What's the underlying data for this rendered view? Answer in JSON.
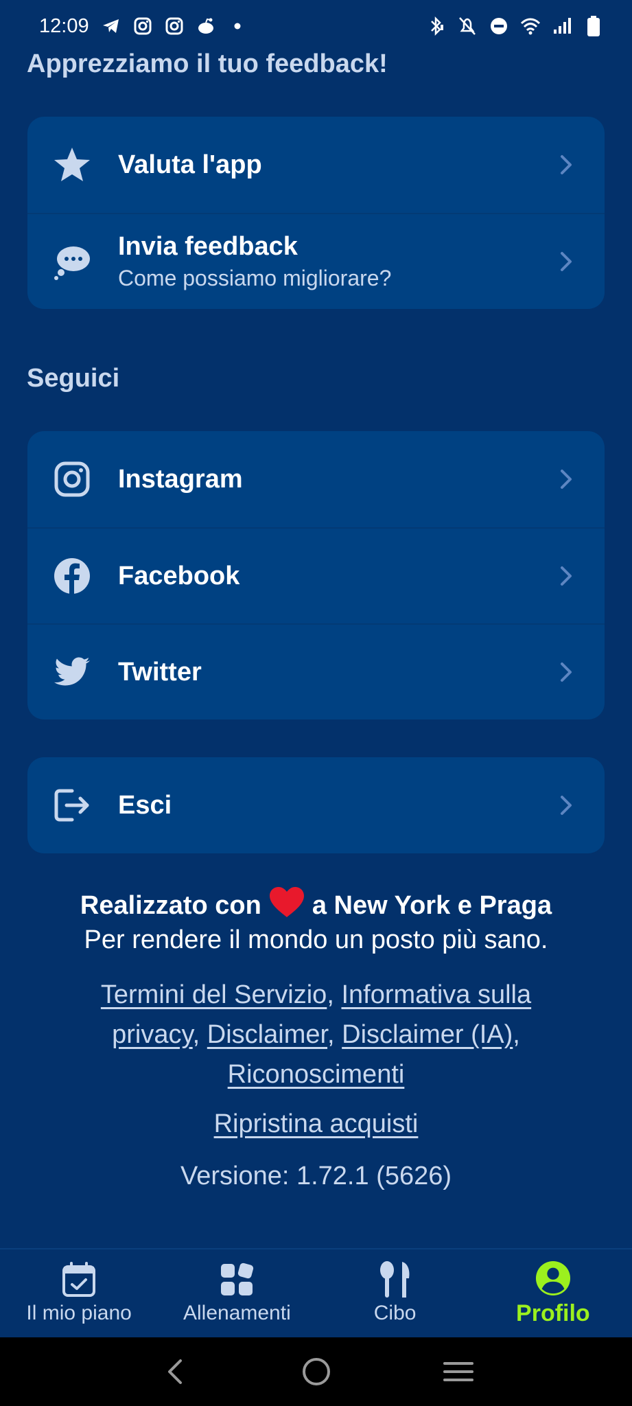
{
  "status_bar": {
    "time": "12:09",
    "left_icons": [
      "telegram-icon",
      "instagram-icon",
      "instagram-icon",
      "reddit-icon",
      "dot-icon"
    ],
    "right_icons": [
      "bluetooth-icon",
      "mute-icon",
      "dnd-icon",
      "wifi-icon",
      "signal-icon",
      "battery-icon"
    ]
  },
  "feedback_section": {
    "title": "Apprezziamo il tuo feedback!",
    "items": [
      {
        "label": "Valuta l'app",
        "subtitle": "",
        "icon": "star-icon"
      },
      {
        "label": "Invia feedback",
        "subtitle": "Come possiamo migliorare?",
        "icon": "thought-bubble-icon"
      }
    ]
  },
  "social_section": {
    "title": "Seguici",
    "items": [
      {
        "label": "Instagram",
        "icon": "instagram-icon"
      },
      {
        "label": "Facebook",
        "icon": "facebook-icon"
      },
      {
        "label": "Twitter",
        "icon": "twitter-icon"
      }
    ]
  },
  "logout": {
    "label": "Esci",
    "icon": "logout-icon"
  },
  "footer": {
    "made_before": "Realizzato con",
    "made_after": "a New York e Praga",
    "mission": "Per rendere il mondo un posto più sano.",
    "links": {
      "terms": "Termini del Servizio",
      "privacy": "Informativa sulla privacy",
      "disclaimer": "Disclaimer",
      "disclaimer_ai": "Disclaimer (IA)",
      "credits": "Riconoscimenti"
    },
    "restore": "Ripristina acquisti",
    "version": "Versione: 1.72.1 (5626)"
  },
  "bottom_nav": {
    "items": [
      {
        "label": "Il mio piano",
        "icon": "calendar-check-icon",
        "active": false
      },
      {
        "label": "Allenamenti",
        "icon": "grid-icon",
        "active": false
      },
      {
        "label": "Cibo",
        "icon": "fork-spoon-icon",
        "active": false
      },
      {
        "label": "Profilo",
        "icon": "profile-icon",
        "active": true
      }
    ]
  },
  "colors": {
    "background": "#03316b",
    "card": "#004182",
    "accent": "#9cf01e",
    "muted_text": "#c9d8ee",
    "heart": "#e8192c"
  }
}
